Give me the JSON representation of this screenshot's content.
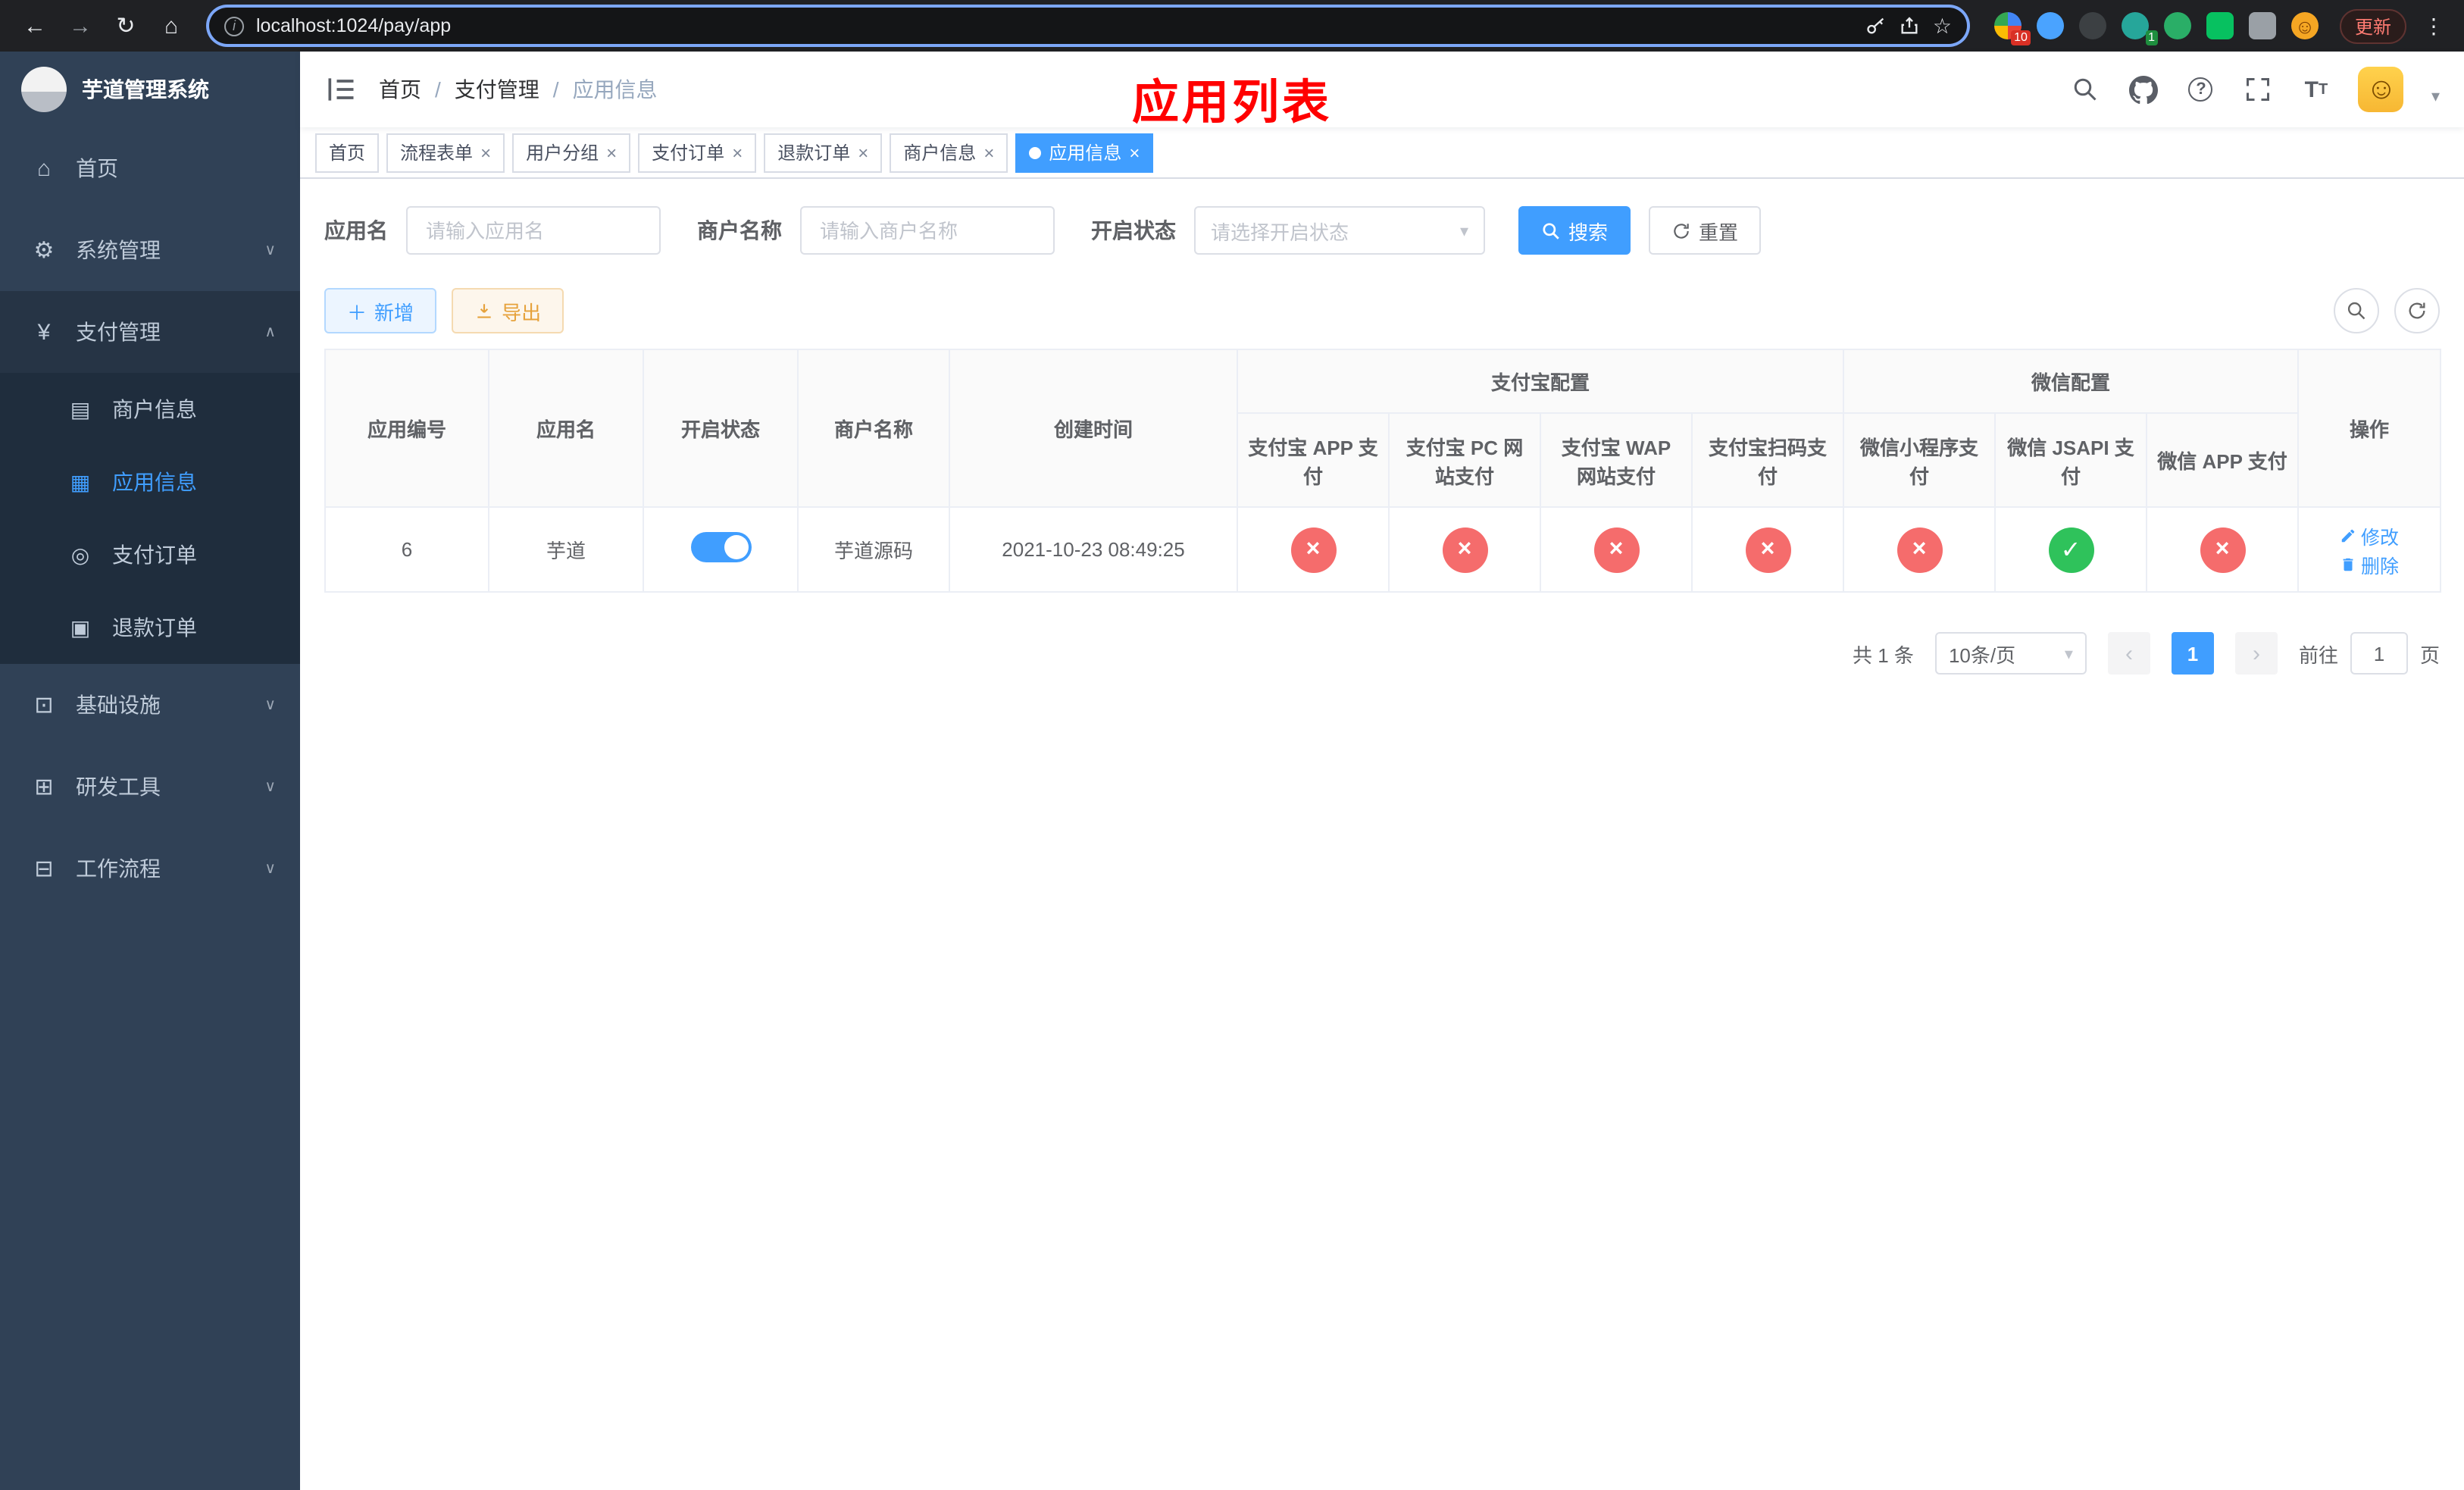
{
  "browser": {
    "url": "localhost:1024/pay/app",
    "update_label": "更新",
    "ext_badge_grid": "10",
    "ext_badge_leaf": "1"
  },
  "sidebar": {
    "title": "芋道管理系统",
    "menu": [
      {
        "icon": "⌂",
        "label": "首页",
        "chevron": ""
      },
      {
        "icon": "⚙",
        "label": "系统管理",
        "chevron": "∨"
      },
      {
        "icon": "¥",
        "label": "支付管理",
        "chevron": "∧"
      },
      {
        "icon": "⊡",
        "label": "基础设施",
        "chevron": "∨"
      },
      {
        "icon": "⊞",
        "label": "研发工具",
        "chevron": "∨"
      },
      {
        "icon": "⊟",
        "label": "工作流程",
        "chevron": "∨"
      }
    ],
    "submenu": [
      {
        "icon": "▤",
        "label": "商户信息"
      },
      {
        "icon": "▦",
        "label": "应用信息"
      },
      {
        "icon": "◎",
        "label": "支付订单"
      },
      {
        "icon": "▣",
        "label": "退款订单"
      }
    ]
  },
  "header": {
    "breadcrumb": [
      "首页",
      "支付管理",
      "应用信息"
    ],
    "breadcrumb_separator": "/",
    "overlay_title": "应用列表"
  },
  "tabs": {
    "close_glyph": "×",
    "items": [
      {
        "label": "首页"
      },
      {
        "label": "流程表单"
      },
      {
        "label": "用户分组"
      },
      {
        "label": "支付订单"
      },
      {
        "label": "退款订单"
      },
      {
        "label": "商户信息"
      },
      {
        "label": "应用信息"
      }
    ]
  },
  "filters": {
    "app_name_label": "应用名",
    "app_name_placeholder": "请输入应用名",
    "merchant_label": "商户名称",
    "merchant_placeholder": "请输入商户名称",
    "status_label": "开启状态",
    "status_placeholder": "请选择开启状态",
    "search_label": "搜索",
    "reset_label": "重置"
  },
  "toolbar": {
    "add_label": "新增",
    "export_label": "导出"
  },
  "table": {
    "headers": {
      "app_id": "应用编号",
      "app_name": "应用名",
      "status": "开启状态",
      "merchant": "商户名称",
      "created": "创建时间",
      "alipay_group": "支付宝配置",
      "wechat_group": "微信配置",
      "actions": "操作"
    },
    "subheaders": [
      "支付宝 APP 支付",
      "支付宝 PC 网站支付",
      "支付宝 WAP 网站支付",
      "支付宝扫码支付",
      "微信小程序支付",
      "微信 JSAPI 支付",
      "微信 APP 支付"
    ],
    "rows": [
      {
        "id": "6",
        "name": "芋道",
        "enabled": true,
        "merchant": "芋道源码",
        "created": "2021-10-23 08:49:25",
        "configs": [
          false,
          false,
          false,
          false,
          false,
          true,
          false
        ],
        "edit_label": "修改",
        "delete_label": "删除"
      }
    ]
  },
  "pagination": {
    "total": "共 1 条",
    "page_size": "10条/页",
    "page": "1",
    "goto_prefix": "前往",
    "goto_value": "1",
    "goto_suffix": "页"
  },
  "colors": {
    "accent": "#409eff",
    "danger": "#f56c6c",
    "success": "#2fc25b",
    "warning": "#e6a23c",
    "sidebar_bg": "#304156",
    "overlay_title": "#ff0000"
  }
}
